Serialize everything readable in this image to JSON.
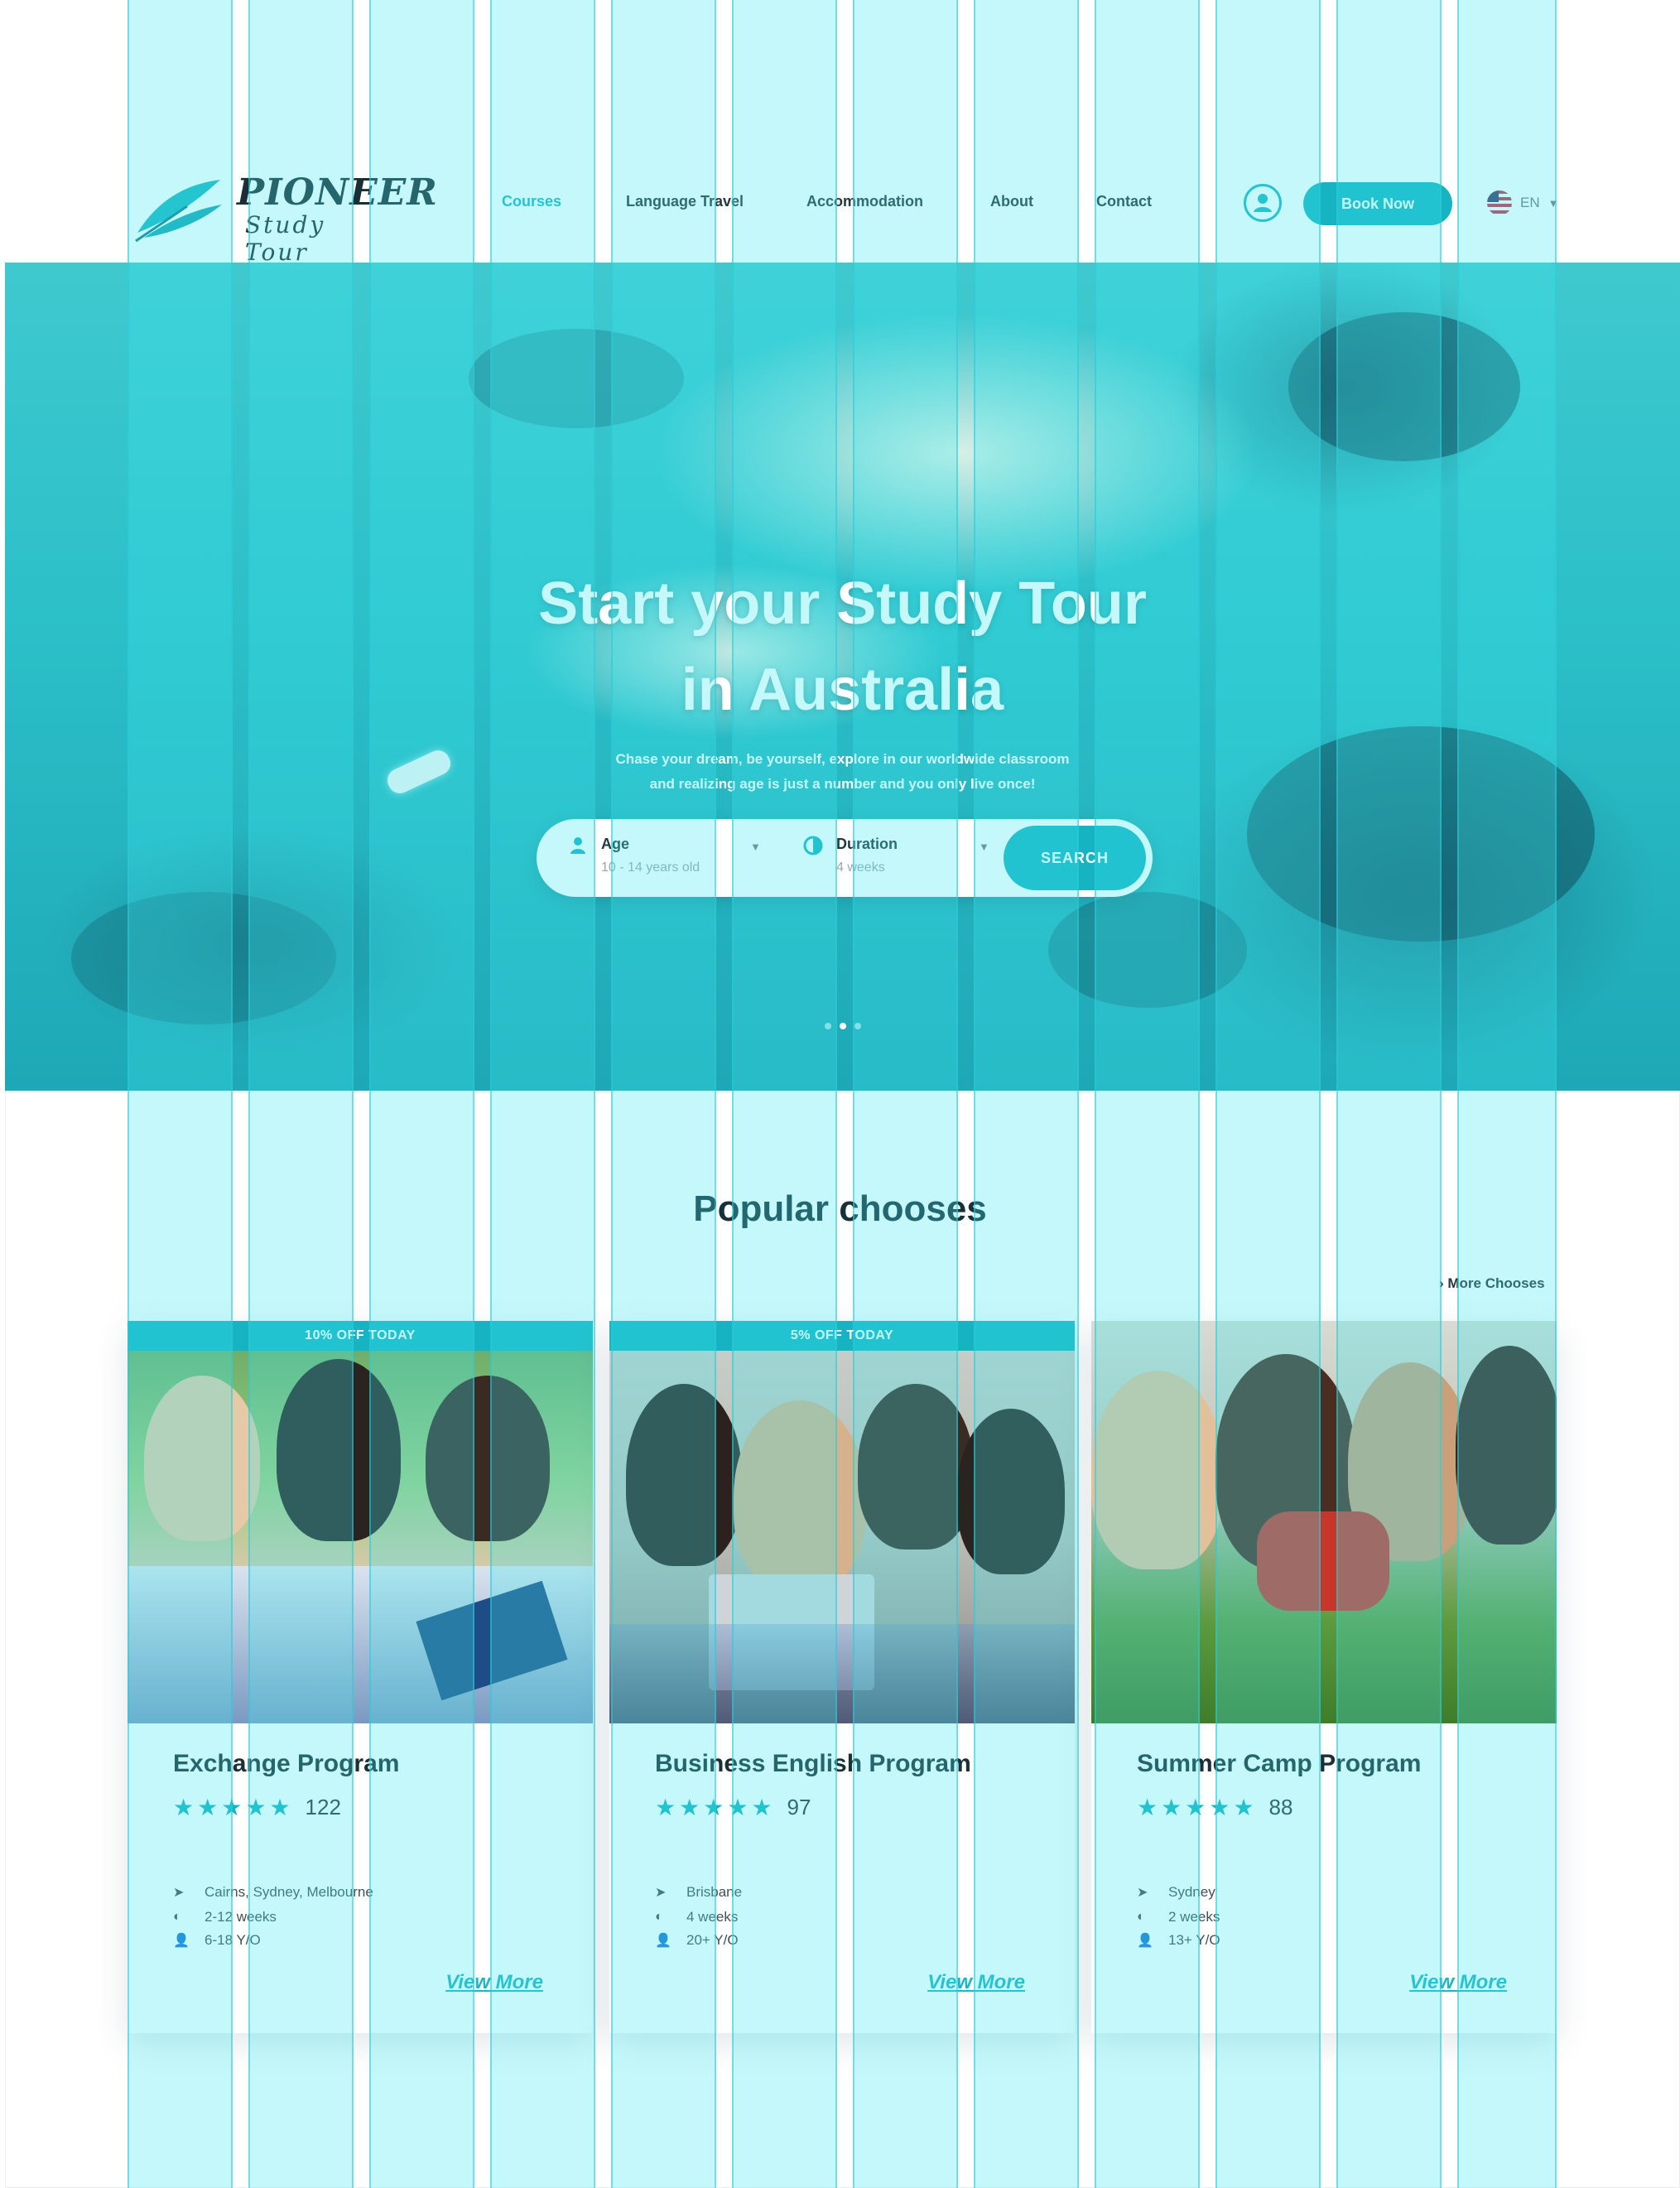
{
  "header": {
    "logo_title": "PIONEER",
    "logo_subtitle": "Study Tour",
    "nav": [
      {
        "label": "Courses",
        "active": true
      },
      {
        "label": "Language Travel",
        "active": false
      },
      {
        "label": "Accommodation",
        "active": false
      },
      {
        "label": "About",
        "active": false
      },
      {
        "label": "Contact",
        "active": false
      }
    ],
    "account_icon": "user-circle-icon",
    "book_label": "Book Now",
    "language": "EN",
    "flag_icon": "us-flag-icon"
  },
  "hero": {
    "title_line1": "Start your Study Tour",
    "title_line2": "in Australia",
    "subtitle_line1": "Chase your dream, be yourself, explore in our worldwide classroom",
    "subtitle_line2": "and realizing age is just a number and you only live once!",
    "search": {
      "age_label": "Age",
      "age_value": "10 - 14 years old",
      "duration_label": "Duration",
      "duration_value": "4 weeks",
      "button_label": "SEARCH"
    },
    "slides": 3,
    "active_slide": 2
  },
  "popular": {
    "title": "Popular chooses",
    "more_label": "More Chooses",
    "cards": [
      {
        "badge": "10% OFF TODAY",
        "title": "Exchange Program",
        "rating": 5,
        "reviews": "122",
        "location": "Cairns, Sydney, Melbourne",
        "duration": "2-12 weeks",
        "age": "6-18 Y/O",
        "link": "View More"
      },
      {
        "badge": "5% OFF TODAY",
        "title": "Business English Program",
        "rating": 5,
        "reviews": "97",
        "location": "Brisbane",
        "duration": "4 weeks",
        "age": "20+ Y/O",
        "link": "View More"
      },
      {
        "badge": "",
        "title": "Summer Camp Program",
        "rating": 5,
        "reviews": "88",
        "location": "Sydney",
        "duration": "2 weeks",
        "age": "13+ Y/O",
        "link": "View More"
      }
    ]
  },
  "colors": {
    "accent": "#16b4c3",
    "text_dark": "#1b2f36",
    "guide_overlay": "#40e8f0"
  }
}
